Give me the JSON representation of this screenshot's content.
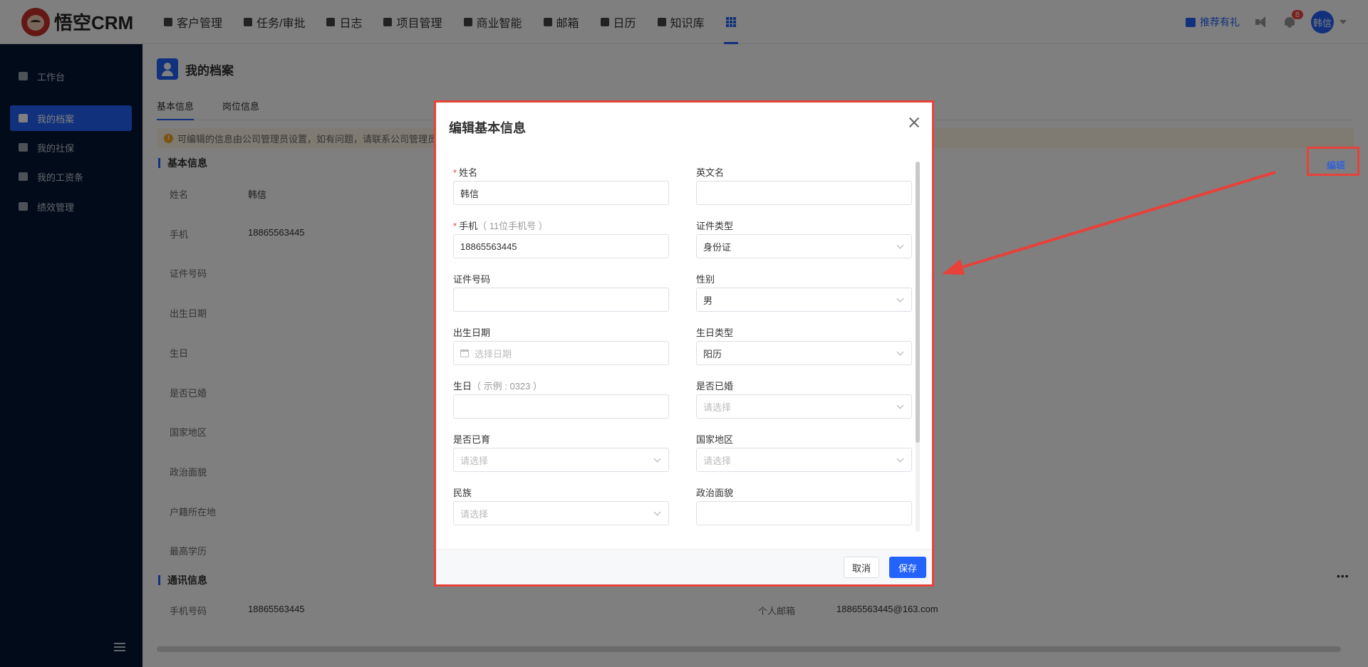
{
  "app": {
    "logo_text": "悟空CRM"
  },
  "nav": [
    {
      "label": "客户管理",
      "icon": "customer-icon"
    },
    {
      "label": "任务/审批",
      "icon": "briefcase-icon"
    },
    {
      "label": "日志",
      "icon": "log-icon"
    },
    {
      "label": "项目管理",
      "icon": "project-icon"
    },
    {
      "label": "商业智能",
      "icon": "bi-icon"
    },
    {
      "label": "邮箱",
      "icon": "mail-icon"
    },
    {
      "label": "日历",
      "icon": "calendar-icon"
    },
    {
      "label": "知识库",
      "icon": "book-icon"
    }
  ],
  "top_right": {
    "gift_label": "推荐有礼",
    "notification_count": "8",
    "user_avatar": "韩信"
  },
  "sidebar": {
    "items": [
      {
        "label": "工作台",
        "icon": "monitor-icon",
        "active": false
      },
      {
        "label": "我的档案",
        "icon": "folder-icon",
        "active": true
      },
      {
        "label": "我的社保",
        "icon": "shield-icon",
        "active": false
      },
      {
        "label": "我的工资条",
        "icon": "payslip-icon",
        "active": false
      },
      {
        "label": "绩效管理",
        "icon": "chart-icon",
        "active": false
      }
    ]
  },
  "page": {
    "title": "我的档案",
    "tabs": [
      "基本信息",
      "岗位信息"
    ],
    "notice": "可编辑的信息由公司管理员设置，如有问题，请联系公司管理员",
    "edit_label": "编辑",
    "sections": {
      "basic": {
        "title": "基本信息",
        "fields": [
          {
            "label": "姓名",
            "value": "韩信"
          },
          {
            "label": "手机",
            "value": "18865563445"
          },
          {
            "label": "证件号码",
            "value": ""
          },
          {
            "label": "出生日期",
            "value": ""
          },
          {
            "label": "生日",
            "value": ""
          },
          {
            "label": "是否已婚",
            "value": ""
          },
          {
            "label": "国家地区",
            "value": ""
          },
          {
            "label": "政治面貌",
            "value": ""
          },
          {
            "label": "户籍所在地",
            "value": ""
          },
          {
            "label": "最高学历",
            "value": ""
          }
        ]
      },
      "contact": {
        "title": "通讯信息",
        "phone_label": "手机号码",
        "phone_value": "18865563445",
        "email_label": "个人邮箱",
        "email_value": "18865563445@163.com"
      }
    }
  },
  "dialog": {
    "title": "编辑基本信息",
    "fields": {
      "name": {
        "label": "姓名",
        "value": "韩信",
        "required": true
      },
      "english_name": {
        "label": "英文名",
        "value": ""
      },
      "mobile": {
        "label": "手机",
        "hint": "（ 11位手机号 ）",
        "value": "18865563445",
        "required": true
      },
      "id_type": {
        "label": "证件类型",
        "value": "身份证"
      },
      "id_number": {
        "label": "证件号码",
        "value": ""
      },
      "gender": {
        "label": "性别",
        "value": "男"
      },
      "birth_date": {
        "label": "出生日期",
        "placeholder": "选择日期"
      },
      "birthday_type": {
        "label": "生日类型",
        "value": "阳历"
      },
      "birthday": {
        "label": "生日",
        "hint": "（ 示例 : 0323 ）",
        "value": ""
      },
      "married": {
        "label": "是否已婚",
        "placeholder": "请选择"
      },
      "has_children": {
        "label": "是否已育",
        "placeholder": "请选择"
      },
      "country": {
        "label": "国家地区",
        "placeholder": "请选择"
      },
      "ethnicity": {
        "label": "民族",
        "placeholder": "请选择"
      },
      "political": {
        "label": "政治面貌",
        "value": ""
      }
    },
    "cancel_label": "取消",
    "save_label": "保存"
  },
  "colors": {
    "accent": "#2362fb",
    "sidebar_bg": "#041634",
    "annotation_red": "#e8413a"
  }
}
